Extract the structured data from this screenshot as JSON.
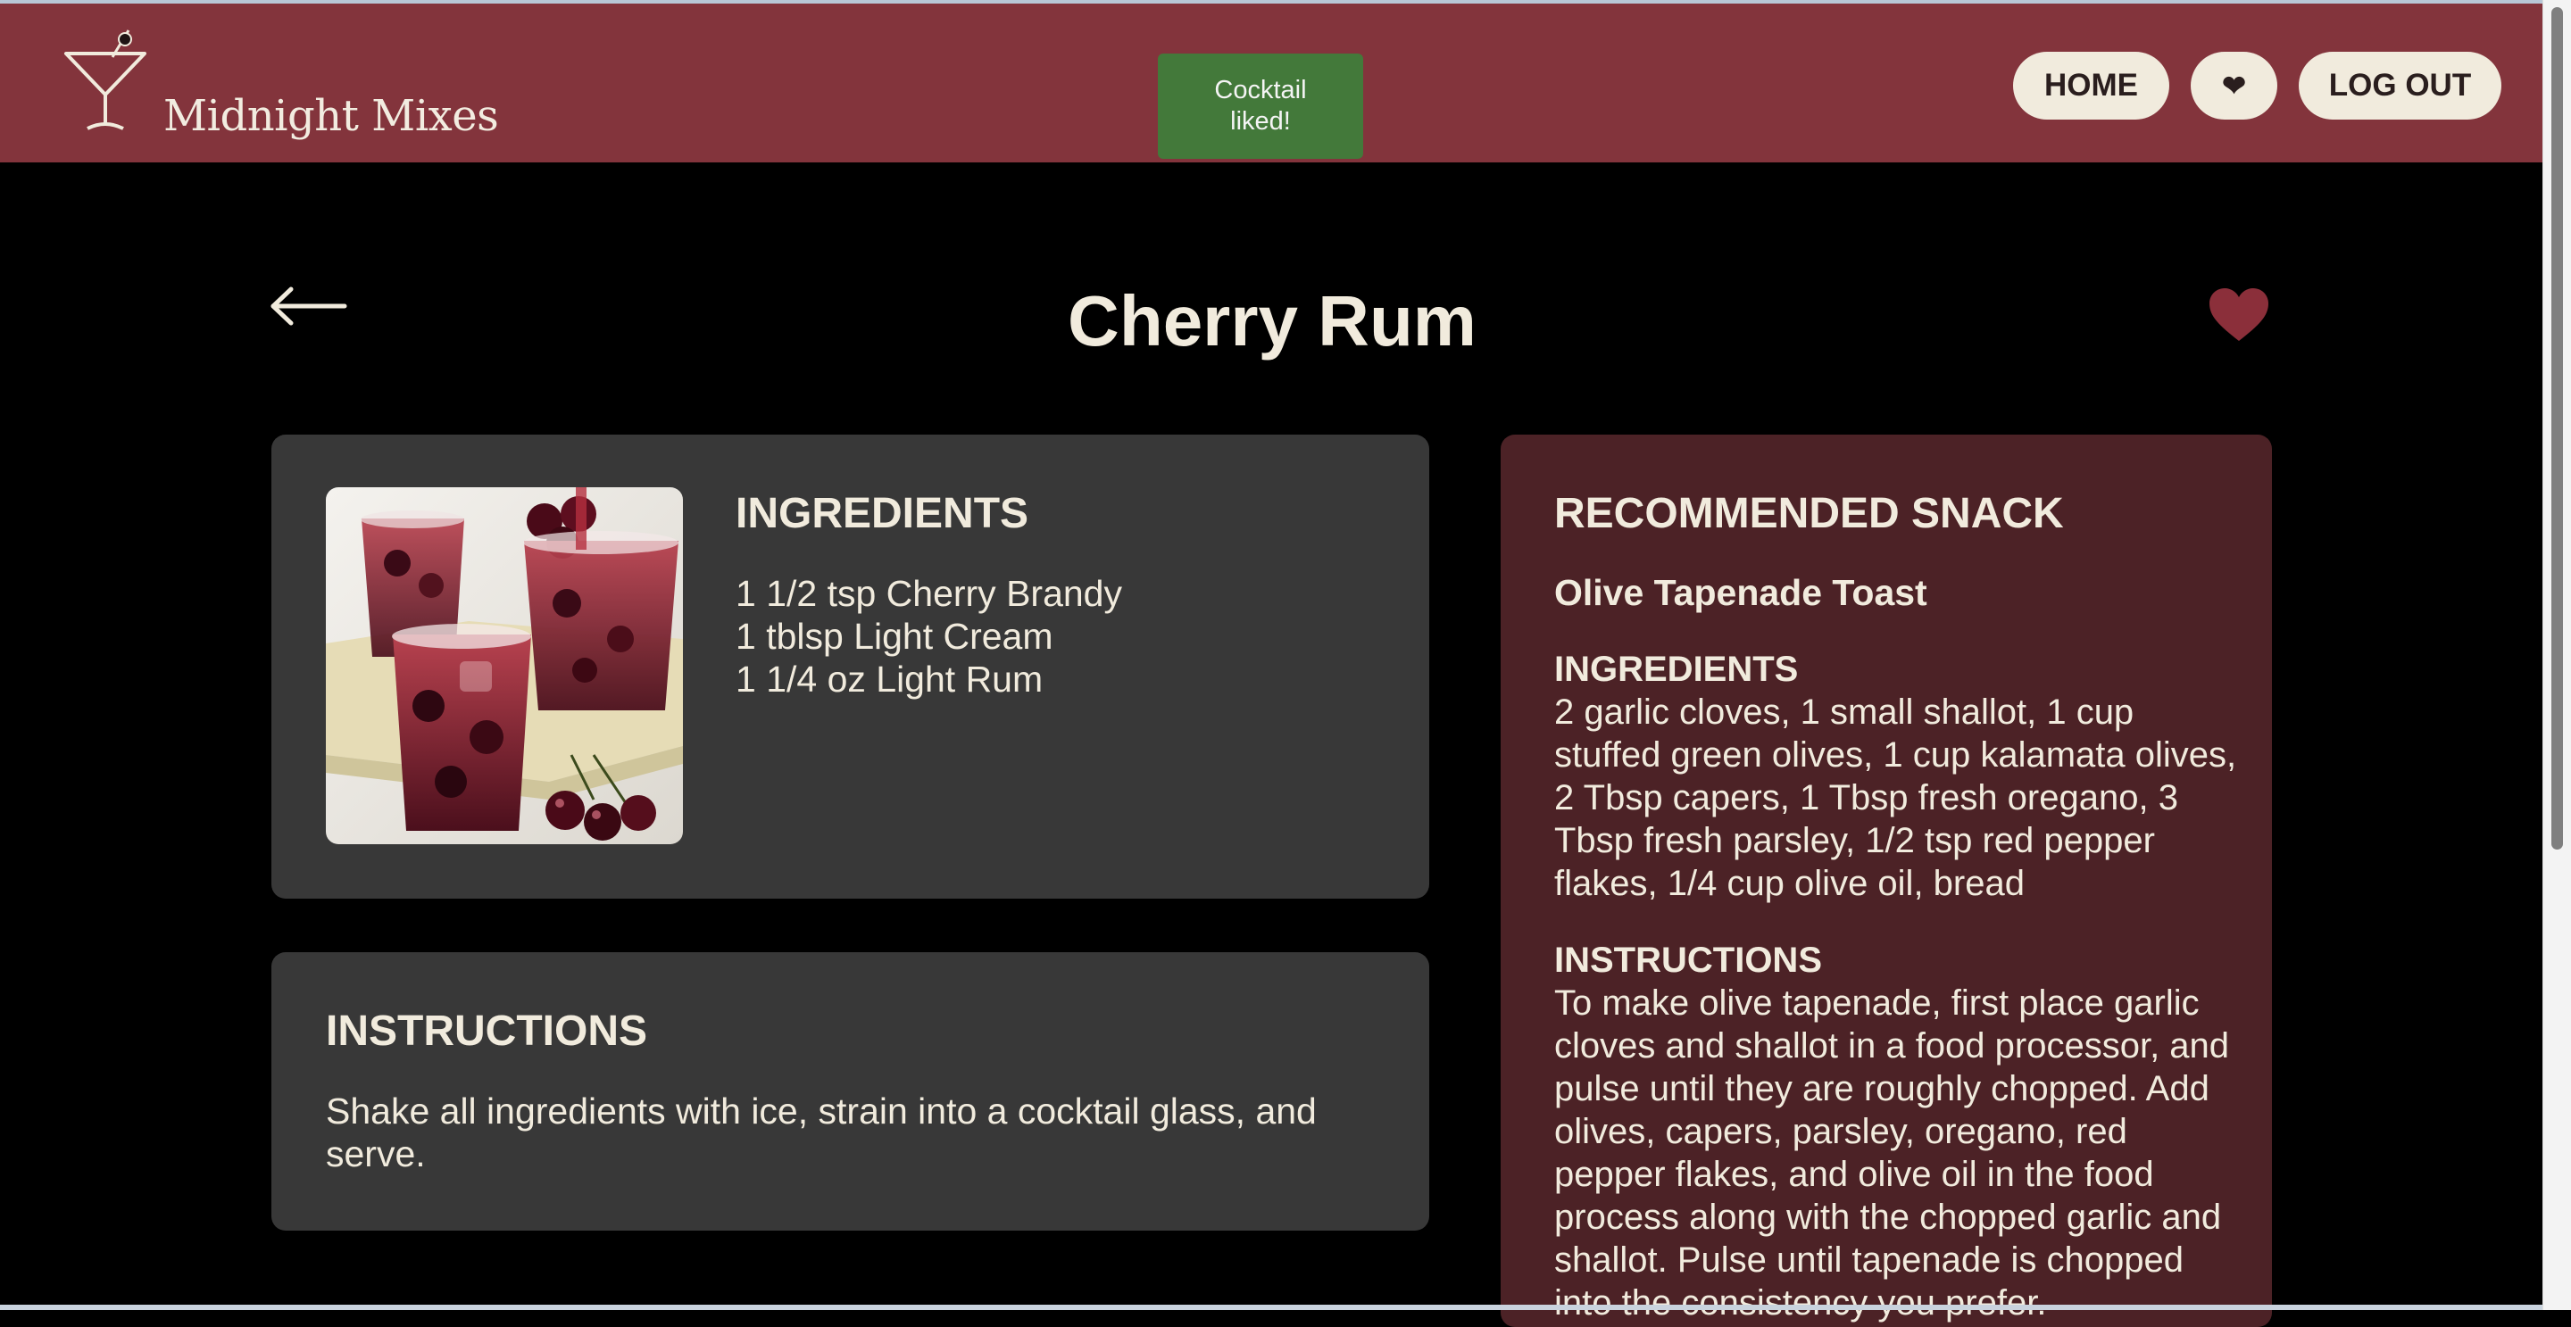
{
  "header": {
    "brand": "Midnight Mixes",
    "toast": "Cocktail liked!",
    "nav": {
      "home": "HOME",
      "favorites": "❤",
      "logout": "LOG OUT"
    }
  },
  "colors": {
    "header_bg": "#83343c",
    "page_bg": "#000000",
    "card_bg": "#383838",
    "snack_card_bg": "#4c2226",
    "toast_bg": "#43793a",
    "accent_text": "#f1ebdd",
    "heart": "#8b2f3a"
  },
  "icons": {
    "logo": "martini-glass-icon",
    "back": "left-arrow-icon",
    "favorite": "heart-icon"
  },
  "cocktail": {
    "title": "Cherry Rum",
    "back_arrow": "←",
    "image_alt": "Cherry Rum cocktail",
    "ingredients_heading": "INGREDIENTS",
    "ingredients": [
      "1 1/2 tsp Cherry Brandy",
      "1 tblsp Light Cream",
      "1 1/4 oz Light Rum"
    ],
    "instructions_heading": "INSTRUCTIONS",
    "instructions": "Shake all ingredients with ice, strain into a cocktail glass, and serve."
  },
  "snack": {
    "heading": "RECOMMENDED SNACK",
    "name": "Olive Tapenade Toast",
    "ingredients_heading": "INGREDIENTS",
    "ingredients": "2 garlic cloves, 1 small shallot, 1 cup stuffed green olives, 1 cup kalamata olives, 2 Tbsp capers, 1 Tbsp fresh oregano, 3 Tbsp fresh parsley, 1/2 tsp red pepper flakes, 1/4 cup olive oil, bread",
    "instructions_heading": "INSTRUCTIONS",
    "instructions": "To make olive tapenade, first place garlic cloves and shallot in a food processor, and pulse until they are roughly chopped. Add olives, capers, parsley, oregano, red pepper flakes, and olive oil in the food process along with the chopped garlic and shallot. Pulse until tapenade is chopped into the consistency you prefer."
  }
}
